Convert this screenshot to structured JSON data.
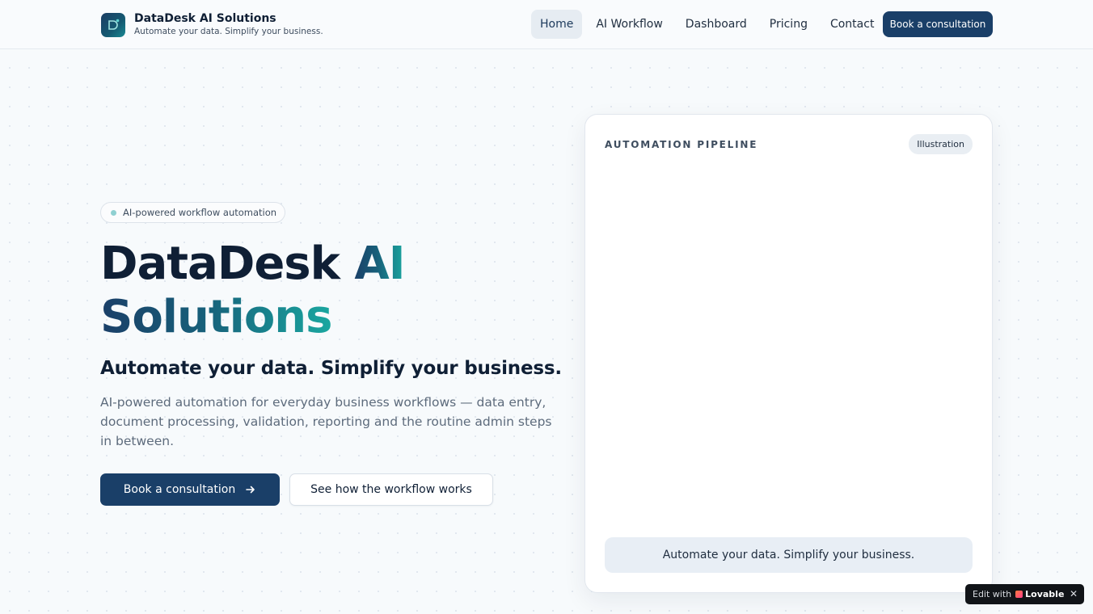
{
  "header": {
    "brand_name": "DataDesk AI Solutions",
    "brand_tagline": "Automate your data. Simplify your business.",
    "nav": [
      {
        "label": "Home",
        "active": true
      },
      {
        "label": "AI Workflow",
        "active": false
      },
      {
        "label": "Dashboard",
        "active": false
      },
      {
        "label": "Pricing",
        "active": false
      },
      {
        "label": "Contact",
        "active": false
      }
    ],
    "cta_label": "Book a consultation"
  },
  "hero": {
    "badge": "AI-powered workflow automation",
    "title_part1": "DataDesk ",
    "title_accent1": "AI",
    "title_accent2": "Solutions",
    "subtitle": "Automate your data. Simplify your business.",
    "description": "AI-powered automation for everyday business workflows — data entry, document processing, validation, reporting and the routine admin steps in between.",
    "primary_button": "Book a consultation",
    "secondary_button": "See how the workflow works"
  },
  "card": {
    "title": "AUTOMATION PIPELINE",
    "tag": "Illustration",
    "footer": "Automate your data. Simplify your business."
  },
  "lovable": {
    "prefix": "Edit with",
    "brand": "Lovable"
  },
  "colors": {
    "primary": "#1a3f68",
    "accent": "#1aa7a0",
    "text": "#0f1f35"
  }
}
